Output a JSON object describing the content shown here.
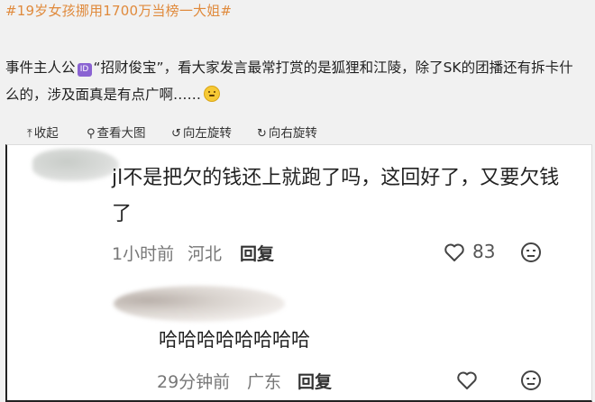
{
  "post": {
    "hashtag": "#19岁女孩挪用1700万当榜一大姐#",
    "text_part1": "事件主人公",
    "id_badge": "ID",
    "text_part2": "“招财俊宝”，看大家发言最常打赏的是狐狸和江陵，除了SK的团播还有拆卡什么的，涉及面真是有点广啊……"
  },
  "toolbar": {
    "collapse": "收起",
    "view_large": "查看大图",
    "rotate_left": "向左旋转",
    "rotate_right": "向右旋转"
  },
  "comments": [
    {
      "text": "jl不是把欠的钱还上就跑了吗，这回好了，又要欠钱了",
      "time": "1小时前",
      "location": "河北",
      "reply": "回复",
      "likes": "83"
    },
    {
      "text": "哈哈哈哈哈哈哈哈",
      "time": "29分钟前",
      "location": "广东",
      "reply": "回复",
      "likes": ""
    }
  ],
  "icons": {
    "collapse": "arrow-up-icon",
    "view_large": "magnifier-icon",
    "rotate_left": "rotate-left-icon",
    "rotate_right": "rotate-right-icon",
    "like": "heart-icon",
    "reaction": "emoji-face-icon"
  },
  "colors": {
    "hashtag": "#e08a3c",
    "id_badge": "#8a63d2"
  }
}
